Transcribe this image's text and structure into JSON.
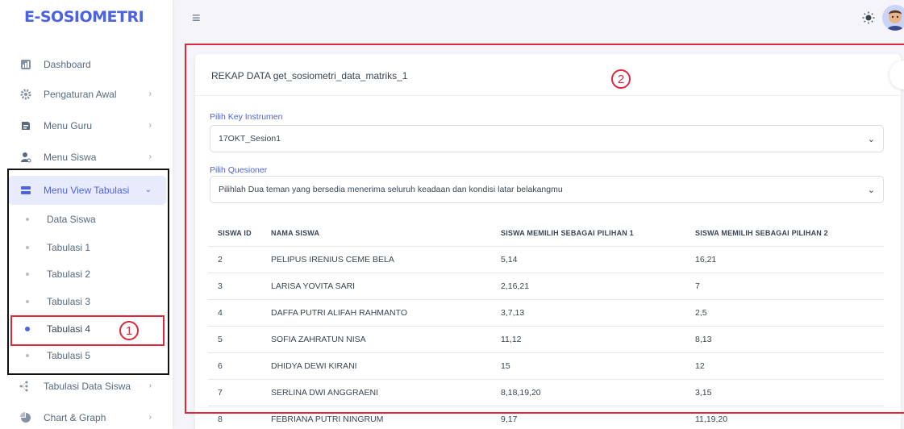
{
  "app": {
    "logo": "E-SOSIOMETRI"
  },
  "sidebar": {
    "items": [
      {
        "label": "Dashboard",
        "icon": "dashboard-icon"
      },
      {
        "label": "Pengaturan Awal",
        "icon": "gear-icon"
      },
      {
        "label": "Menu Guru",
        "icon": "teacher-icon"
      },
      {
        "label": "Menu Siswa",
        "icon": "student-icon"
      },
      {
        "label": "Menu View Tabulasi",
        "icon": "table-icon"
      },
      {
        "label": "Tabulasi Data Siswa",
        "icon": "network-icon"
      },
      {
        "label": "Chart & Graph",
        "icon": "pie-chart-icon"
      }
    ],
    "sub_items": [
      {
        "label": "Data Siswa"
      },
      {
        "label": "Tabulasi 1"
      },
      {
        "label": "Tabulasi 2"
      },
      {
        "label": "Tabulasi 3"
      },
      {
        "label": "Tabulasi 4"
      },
      {
        "label": "Tabulasi 5"
      }
    ]
  },
  "annotations": {
    "marker1": "1",
    "marker2": "2"
  },
  "card": {
    "title_prefix": "REKAP DATA ",
    "title_name": "get_sosiometri_data_matriks_1",
    "key_label": "Pilih Key Instrumen",
    "key_value": "17OKT_Sesion1",
    "questioner_label": "Pilih Quesioner",
    "questioner_value": "Pilihlah Dua teman yang bersedia menerima seluruh keadaan dan kondisi latar belakangmu"
  },
  "table": {
    "headers": [
      "SISWA ID",
      "NAMA SISWA",
      "SISWA MEMILIH SEBAGAI PILIHAN 1",
      "SISWA MEMILIH SEBAGAI PILIHAN 2"
    ],
    "rows": [
      [
        "2",
        "PELIPUS IRENIUS CEME BELA",
        "5,14",
        "16,21"
      ],
      [
        "3",
        "LARISA YOVITA SARI",
        "2,16,21",
        "7"
      ],
      [
        "4",
        "DAFFA PUTRI ALIFAH RAHMANTO",
        "3,7,13",
        "2,5"
      ],
      [
        "5",
        "SOFIA ZAHRATUN NISA",
        "11,12",
        "8,13"
      ],
      [
        "6",
        "DHIDYA DEWI KIRANI",
        "15",
        "12"
      ],
      [
        "7",
        "SERLINA DWI ANGGRAENI",
        "8,18,19,20",
        "3,15"
      ],
      [
        "8",
        "FEBRIANA PUTRI NINGRUM",
        "9,17",
        "11,19,20"
      ]
    ]
  },
  "colors": {
    "accent": "#4d63e0",
    "annotation": "#e0263a"
  }
}
